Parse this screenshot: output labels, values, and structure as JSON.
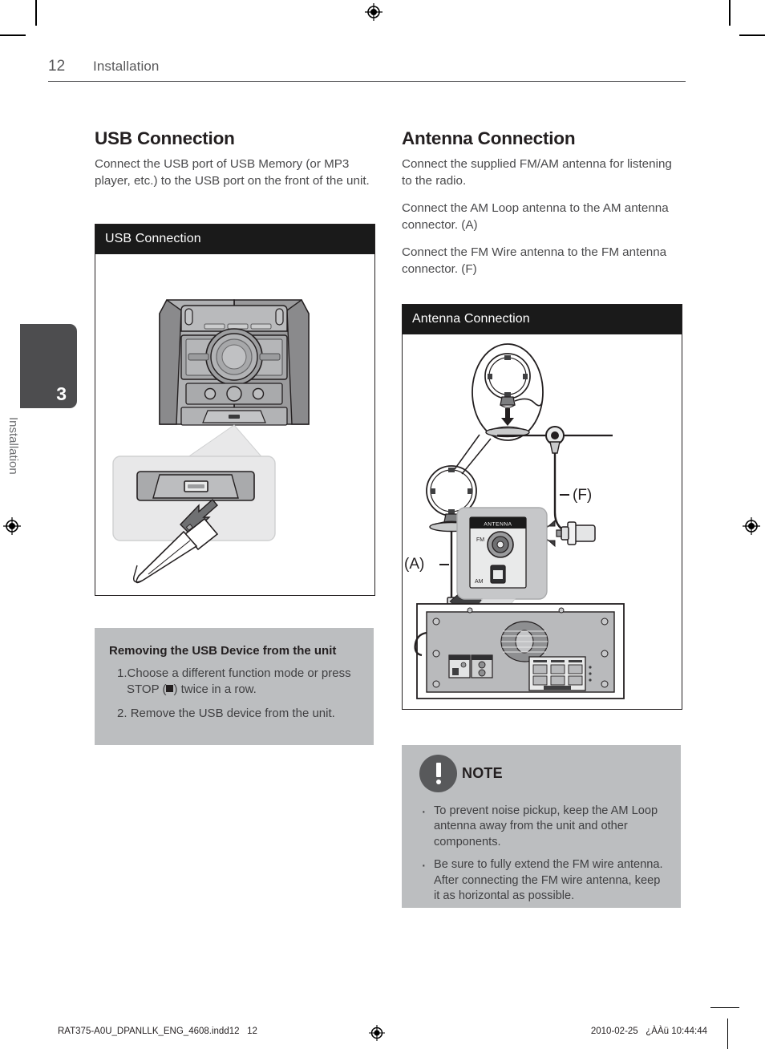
{
  "page": {
    "number": "12",
    "running_head": "Installation"
  },
  "side_tab": {
    "chapter_number": "3",
    "chapter_label": "Installation"
  },
  "left_column": {
    "heading": "USB Connection",
    "paragraphs": [
      "Connect the USB port of USB Memory (or MP3 player, etc.) to the USB port on the front of the unit."
    ],
    "figure": {
      "caption": "USB Connection",
      "alt_parts": [
        "mini-hifi-front-unit",
        "usb-port-callout",
        "usb-flash-drive"
      ]
    },
    "removal_box": {
      "title": "Removing the USB Device from the unit",
      "steps": [
        {
          "number": "1.",
          "text_before": "Choose a different function mode or press STOP (",
          "symbol": "stop-square",
          "text_after": ") twice in a row."
        },
        {
          "number": "2.",
          "text_before": "Remove the USB device from the unit.",
          "symbol": "",
          "text_after": ""
        }
      ]
    }
  },
  "right_column": {
    "heading": "Antenna Connection",
    "paragraphs": [
      "Connect the supplied FM/AM antenna for listening to the radio.",
      "Connect the AM Loop antenna to the AM antenna connector. (A)",
      "Connect the FM Wire antenna to the FM antenna connector. (F)"
    ],
    "figure": {
      "caption": "Antenna Connection",
      "labels": {
        "am": "(A)",
        "fm": "(F)",
        "panel": "ANTENNA",
        "panel_fm": "FM",
        "panel_am": "AM"
      }
    },
    "note_box": {
      "icon": "exclamation-circle-icon",
      "title": "NOTE",
      "bullets": [
        "To prevent noise pickup, keep the AM Loop antenna away from the unit and other components.",
        "Be sure to fully extend the FM wire antenna. After connecting the FM wire antenna, keep it as horizontal as possible."
      ]
    }
  },
  "footer": {
    "file_name": "RAT375-A0U_DPANLLK_ENG_4608.indd12   12",
    "timestamp": "2010-02-25   ¿ÀÀü 10:44:44",
    "center_mark": "registration-mark"
  },
  "colors": {
    "figure_header_bg": "#1a1a1a",
    "gray_box_bg": "#bcbec0",
    "side_tab_bg": "#4d4d4f",
    "body_text": "#4a4a4c",
    "heading_text": "#231f20"
  }
}
